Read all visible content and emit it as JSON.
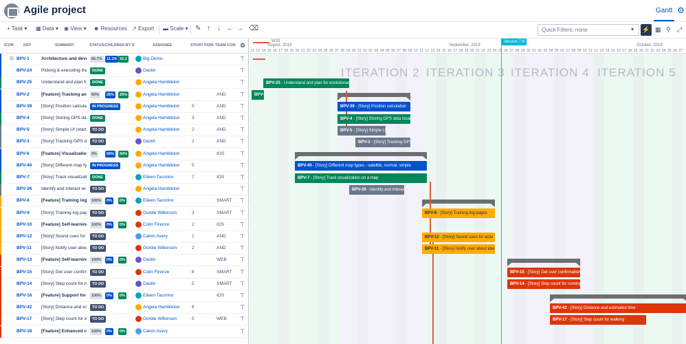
{
  "header": {
    "title": "Agile project",
    "gantt_tab": "Gantt"
  },
  "toolbar": {
    "task": "Task",
    "data": "Data",
    "view": "View",
    "resources": "Resources",
    "export": "Export",
    "scale": "Scale",
    "quick_filters": "Quick Filters: none"
  },
  "columns": {
    "icon": "ICON",
    "key": "KEY",
    "summary": "SUMMARY",
    "status": "STATUS/CHILDREN BY ST",
    "assignee": "ASSIGNEE",
    "story_points": "STORY POINTS",
    "team": "TEAM CODE"
  },
  "timeline": {
    "week_label": "W33",
    "months": [
      "August, 2019",
      "September, 2019",
      "October, 2019"
    ],
    "days": [
      "12",
      "13",
      "14",
      "15",
      "16",
      "17",
      "18",
      "19",
      "20",
      "21",
      "22",
      "23",
      "24",
      "25",
      "26",
      "27",
      "28",
      "29",
      "30",
      "31",
      "01",
      "02",
      "03",
      "04",
      "05",
      "06",
      "07",
      "08",
      "09",
      "10",
      "11",
      "12",
      "13",
      "14",
      "15",
      "16",
      "17",
      "18",
      "19",
      "20",
      "21",
      "22",
      "23",
      "24",
      "25",
      "26",
      "27",
      "28",
      "29",
      "30",
      "01",
      "02",
      "03",
      "04",
      "05",
      "06",
      "07",
      "08",
      "09",
      "10",
      "11",
      "12",
      "13",
      "14",
      "15",
      "16",
      "17",
      "18",
      "19",
      "20",
      "21",
      "22",
      "23",
      "24",
      "25",
      "26",
      "27"
    ],
    "iterations": [
      "ITERATION 2",
      "ITERATION 3",
      "ITERATION 4",
      "ITERATION 5"
    ],
    "version": "Version 7.6"
  },
  "rows": [
    {
      "key": "BPV-1",
      "summary": "Architecture and devel",
      "bold": true,
      "pcts": [
        "66.7%",
        "11.1%",
        "22.2"
      ],
      "assignee": "Big Demo",
      "sp": "",
      "team": "",
      "stripe": "#0052cc",
      "av": "#00a3bf"
    },
    {
      "key": "BPV-24",
      "summary": "Picking & executing the",
      "status": "DONE",
      "assignee": "Dastin",
      "sp": "",
      "team": "",
      "stripe": "#0052cc",
      "av": "#6554c0"
    },
    {
      "key": "BPV-25",
      "summary": "Understand and plan fo",
      "status": "DONE",
      "assignee": "Angela Hambleton",
      "sp": "",
      "team": "",
      "stripe": "#00875a",
      "av": "#ffab00"
    },
    {
      "key": "BPV-2",
      "summary": "[Feature] Tracking and",
      "bold": true,
      "pcts": [
        "50%",
        "25%",
        "25%"
      ],
      "assignee": "Angela Hambleton",
      "sp": "",
      "team": "AND",
      "stripe": "#0052cc",
      "av": "#ffab00"
    },
    {
      "key": "BPV-39",
      "summary": "[Story] Position calculat",
      "status": "IN PROGRESS",
      "assignee": "Angela Hambleton",
      "sp": "5",
      "team": "AND",
      "stripe": "#0052cc",
      "av": "#ffab00"
    },
    {
      "key": "BPV-4",
      "summary": "[Story] Storing GPS data",
      "status": "DONE",
      "assignee": "Angela Hambleton",
      "sp": "3",
      "team": "AND",
      "stripe": "#00875a",
      "av": "#ffab00"
    },
    {
      "key": "BPV-5",
      "summary": "[Story] Simple UI (start,",
      "status": "TO DO",
      "assignee": "Angela Hambleton",
      "sp": "2",
      "team": "AND",
      "stripe": "#6b778c",
      "av": "#ffab00"
    },
    {
      "key": "BPV-3",
      "summary": "[Story] Tracking GPS da",
      "status": "TO DO",
      "assignee": "Dastin",
      "sp": "2",
      "team": "AND",
      "stripe": "#6b778c",
      "av": "#6554c0"
    },
    {
      "key": "BPV-6",
      "summary": "[Feature] Visualization",
      "bold": true,
      "pcts": [
        "0%",
        "50%",
        "50%"
      ],
      "assignee": "Angela Hambleton",
      "sp": "",
      "team": "IOS",
      "stripe": "#0052cc",
      "av": "#ffab00"
    },
    {
      "key": "BPV-40",
      "summary": "[Story] Different map ty",
      "status": "IN PROGRESS",
      "assignee": "Angela Hambleton",
      "sp": "5",
      "team": "",
      "stripe": "#0052cc",
      "av": "#ffab00"
    },
    {
      "key": "BPV-7",
      "summary": "[Story] Track visualizati",
      "status": "DONE",
      "assignee": "Eileen Tacorino",
      "sp": "7",
      "team": "IOS",
      "stripe": "#00875a",
      "av": "#00a3bf"
    },
    {
      "key": "BPV-26",
      "summary": "Identify and interact wi",
      "status": "TO DO",
      "assignee": "Angela Hambleton",
      "sp": "",
      "team": "",
      "stripe": "#6b778c",
      "av": "#ffab00"
    },
    {
      "key": "BPV-8",
      "summary": "[Feature] Training log",
      "bold": true,
      "pcts": [
        "100%",
        "0%",
        "0%"
      ],
      "assignee": "Eileen Tacorino",
      "sp": "",
      "team": "SMART",
      "stripe": "#ffab00",
      "av": "#00a3bf"
    },
    {
      "key": "BPV-9",
      "summary": "[Story] Training log pag",
      "status": "TO DO",
      "assignee": "Gordie Wilkinson",
      "sp": "3",
      "team": "SMART",
      "stripe": "#ffab00",
      "av": "#de350b"
    },
    {
      "key": "BPV-10",
      "summary": "[Feature] Self-learning",
      "bold": true,
      "pcts": [
        "100%",
        "0%",
        "0%"
      ],
      "assignee": "Colin Firenze",
      "sp": "2",
      "team": "IOS",
      "stripe": "#ffab00",
      "av": "#de350b"
    },
    {
      "key": "BPV-12",
      "summary": "[Story] Sound cues for a",
      "status": "TO DO",
      "assignee": "Calvin Avery",
      "sp": "1",
      "team": "AND",
      "stripe": "#ffab00",
      "av": "#4c9aff"
    },
    {
      "key": "BPV-11",
      "summary": "[Story] Notify user abou",
      "status": "TO DO",
      "assignee": "Gordie Wilkinson",
      "sp": "2",
      "team": "AND",
      "stripe": "#ffab00",
      "av": "#de350b"
    },
    {
      "key": "BPV-13",
      "summary": "[Feature] Self-learning",
      "bold": true,
      "pcts": [
        "100%",
        "0%",
        "0%"
      ],
      "assignee": "Dastin",
      "sp": "",
      "team": "WEB",
      "stripe": "#de350b",
      "av": "#6554c0"
    },
    {
      "key": "BPV-15",
      "summary": "[Story] Get user confirm",
      "status": "TO DO",
      "assignee": "Colin Firenze",
      "sp": "8",
      "team": "SMART",
      "stripe": "#de350b",
      "av": "#de350b"
    },
    {
      "key": "BPV-14",
      "summary": "[Story] Step count for ru",
      "status": "TO DO",
      "assignee": "Dastin",
      "sp": "5",
      "team": "SMART",
      "stripe": "#de350b",
      "av": "#6554c0"
    },
    {
      "key": "BPV-16",
      "summary": "[Feature] Support for cy",
      "bold": true,
      "pcts": [
        "100%",
        "0%",
        "0%"
      ],
      "assignee": "Eileen Tacorino",
      "sp": "",
      "team": "IOS",
      "stripe": "#de350b",
      "av": "#00a3bf"
    },
    {
      "key": "BPV-42",
      "summary": "[Story] Distance and es",
      "status": "TO DO",
      "assignee": "Angela Hambleton",
      "sp": "8",
      "team": "",
      "stripe": "#de350b",
      "av": "#ffab00"
    },
    {
      "key": "BPV-17",
      "summary": "[Story] Step count for w",
      "status": "TO DO",
      "assignee": "Gordie Wilkinson",
      "sp": "5",
      "team": "WEB",
      "stripe": "#de350b",
      "av": "#de350b"
    },
    {
      "key": "BPV-18",
      "summary": "[Feature] Enhanced rep",
      "bold": true,
      "pcts": [
        "100%",
        "0%",
        "0%"
      ],
      "assignee": "Calvin Avery",
      "sp": "",
      "team": "",
      "stripe": "#de350b",
      "av": "#4c9aff"
    }
  ],
  "bars": [
    {
      "key": "BPV-2",
      "label": ""
    },
    {
      "key": "BPV-25",
      "label": " - Understand and plan for evolutionary"
    },
    {
      "key": "BPV-39",
      "label": " - [Story] Position calculation"
    },
    {
      "key": "BPV-4",
      "label": " - [Story] Storing GPS data locally"
    },
    {
      "key": "BPV-5",
      "label": " - [Story] Simple UI (st"
    },
    {
      "key": "BPV-3",
      "label": " - [Story] Tracking GPS d"
    },
    {
      "key": "BPV-40",
      "label": " - [Story] Different map types - satellite, normal, simple"
    },
    {
      "key": "BPV-7",
      "label": " - [Story] Track visualization on a map"
    },
    {
      "key": "BPV-26",
      "label": " - Identify and interact"
    },
    {
      "key": "BPV-9",
      "label": " - [Story] Training log pages"
    },
    {
      "key": "BPV-12",
      "label": " - [Story] Sound cues for activ"
    },
    {
      "key": "BPV-11",
      "label": " - [Story] Notify user about identi"
    },
    {
      "key": "BPV-15",
      "label": " - [Story] Get user confirmation o"
    },
    {
      "key": "BPV-14",
      "label": " - [Story] Step count for running"
    },
    {
      "key": "BPV-42",
      "label": " - [Story] Distance and estimated time"
    },
    {
      "key": "BPV-17",
      "label": " - [Story] Step count for walking"
    }
  ]
}
